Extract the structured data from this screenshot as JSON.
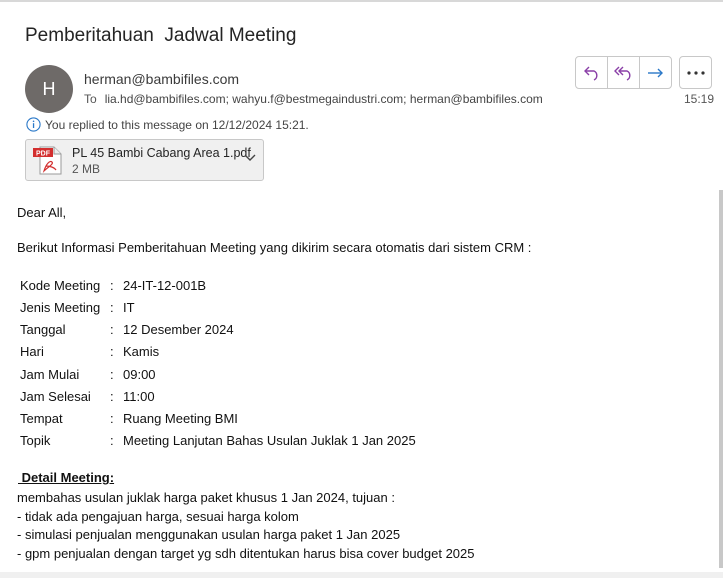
{
  "email": {
    "subject": "Pemberitahuan  Jadwal Meeting",
    "avatar_initial": "H",
    "sender": "herman@bambifiles.com",
    "to_label": "To",
    "recipients": "lia.hd@bambifiles.com; wahyu.f@bestmegaindustri.com; herman@bambifiles.com",
    "time": "15:19",
    "replied_info": "You replied to this message on 12/12/2024 15:21.",
    "attachment": {
      "name": "PL 45 Bambi Cabang Area 1.pdf",
      "size": "2 MB",
      "type_label": "PDF"
    }
  },
  "actions": {
    "reply": "reply-icon",
    "reply_all": "reply-all-icon",
    "forward": "forward-icon",
    "more": "more-icon"
  },
  "body": {
    "greeting": "Dear All,",
    "intro": "Berikut Informasi Pemberitahuan Meeting yang dikirim secara otomatis dari sistem CRM :",
    "separator": ":",
    "details": [
      {
        "key": "Kode Meeting",
        "value": "24-IT-12-001B"
      },
      {
        "key": "Jenis Meeting",
        "value": "IT"
      },
      {
        "key": "Tanggal",
        "value": "12 Desember 2024"
      },
      {
        "key": "Hari",
        "value": "Kamis"
      },
      {
        "key": "Jam Mulai",
        "value": "09:00"
      },
      {
        "key": "Jam Selesai",
        "value": "11:00"
      },
      {
        "key": "Tempat",
        "value": "Ruang Meeting BMI"
      },
      {
        "key": "Topik",
        "value": "Meeting Lanjutan Bahas Usulan Juklak 1 Jan 2025"
      }
    ],
    "detail_heading": " Detail Meeting:",
    "detail_lines": [
      "membahas usulan juklak harga paket khusus 1 Jan 2024, tujuan :",
      "- tidak ada pengajuan harga, sesuai harga kolom",
      "- simulasi penjualan menggunakan usulan harga paket 1 Jan 2025",
      "- gpm penjualan dengan target yg sdh ditentukan harus bisa cover budget 2025"
    ]
  },
  "colors": {
    "accent_purple": "#8a3fa7",
    "accent_blue": "#2a78c8",
    "pdf_red": "#d32f2f"
  }
}
